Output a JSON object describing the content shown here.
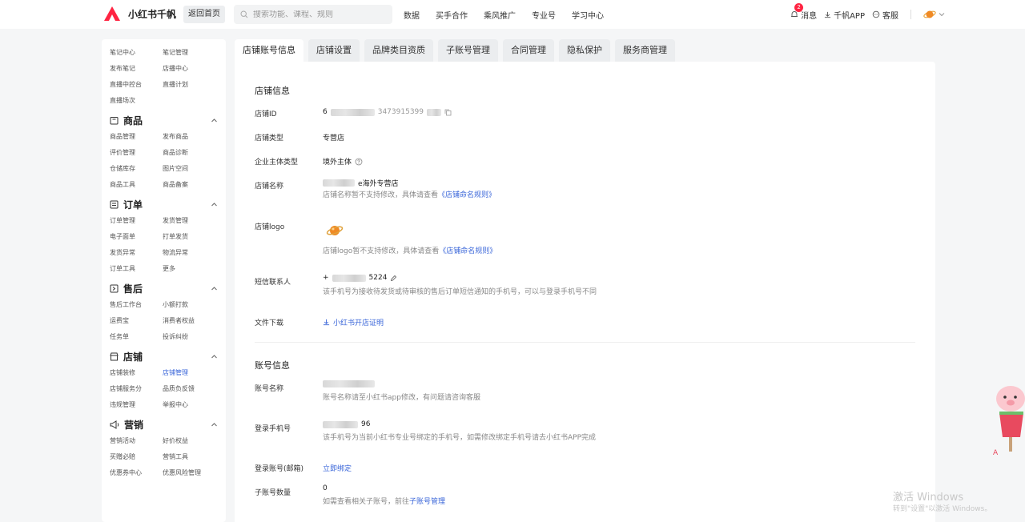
{
  "topbar": {
    "brand": "小红书千帆",
    "back_home": "返回首页",
    "search_placeholder": "搜索功能、课程、规则",
    "nav": [
      "数据",
      "买手合作",
      "乘风推广",
      "专业号",
      "学习中心"
    ],
    "messages_label": "消息",
    "messages_count": "2",
    "app_label": "千帆APP",
    "service_label": "客服"
  },
  "sidebar": {
    "top_items": [
      "笔记中心",
      "笔记管理",
      "发布笔记",
      "店播中心",
      "直播中控台",
      "直播计划",
      "直播场次"
    ],
    "sections": [
      {
        "title": "商品",
        "icon": "product-icon",
        "items": [
          "商品管理",
          "发布商品",
          "评价管理",
          "商品诊断",
          "仓储库存",
          "图片空间",
          "商品工具",
          "商品备案"
        ]
      },
      {
        "title": "订单",
        "icon": "order-icon",
        "items": [
          "订单管理",
          "发货管理",
          "电子面单",
          "打单发货",
          "发货异常",
          "物流异常",
          "订单工具",
          "更多"
        ]
      },
      {
        "title": "售后",
        "icon": "aftersale-icon",
        "items": [
          "售后工作台",
          "小额打款",
          "运费宝",
          "消费者权益",
          "任务单",
          "投诉纠纷"
        ]
      },
      {
        "title": "店铺",
        "icon": "store-icon",
        "items": [
          "店铺装修",
          "店铺管理",
          "店铺服务分",
          "品质负反馈",
          "违规管理",
          "举报中心"
        ],
        "active": "店铺管理"
      },
      {
        "title": "营销",
        "icon": "marketing-icon",
        "items": [
          "营销活动",
          "好价权益",
          "买赠必赔",
          "营销工具",
          "优惠券中心",
          "优惠风险管理"
        ]
      }
    ]
  },
  "tabs": [
    "店铺账号信息",
    "店铺设置",
    "品牌类目资质",
    "子账号管理",
    "合同管理",
    "隐私保护",
    "服务商管理"
  ],
  "store_info": {
    "heading": "店铺信息",
    "id_label": "店铺ID",
    "id_value_partial": "6",
    "id_value_partial2": "3473915399",
    "type_label": "店铺类型",
    "type_value": "专营店",
    "entity_label": "企业主体类型",
    "entity_value": "境外主体",
    "name_label": "店铺名称",
    "name_value_suffix": "e海外专营店",
    "name_hint": "店铺名称暂不支持修改，具体请查看",
    "name_rule_link": "《店铺命名规则》",
    "logo_label": "店铺logo",
    "logo_hint": "店铺logo暂不支持修改，具体请查看",
    "logo_rule_link": "《店铺命名规则》",
    "sms_label": "短信联系人",
    "sms_value_prefix": "+",
    "sms_value_suffix": "5224",
    "sms_hint": "该手机号为接收待发货或待审核的售后订单短信通知的手机号，可以与登录手机号不同",
    "file_label": "文件下载",
    "file_link": "小红书开店证明"
  },
  "account_info": {
    "heading": "账号信息",
    "name_label": "账号名称",
    "name_hint": "账号名称请至小红书app修改，有问题请咨询客服",
    "phone_label": "登录手机号",
    "phone_suffix": "96",
    "phone_hint": "该手机号为当前小红书专业号绑定的手机号，如需修改绑定手机号请去小红书APP完成",
    "email_label": "登录账号(邮箱)",
    "email_link": "立即绑定",
    "sub_label": "子账号数量",
    "sub_value": "0",
    "sub_hint": "如需查看相关子账号，前往",
    "sub_link": "子账号管理"
  },
  "watermark": {
    "line1": "激活 Windows",
    "line2": "转到\"设置\"以激活 Windows。"
  },
  "colors": {
    "accent": "#3a66d9",
    "brand": "#ff2442"
  }
}
